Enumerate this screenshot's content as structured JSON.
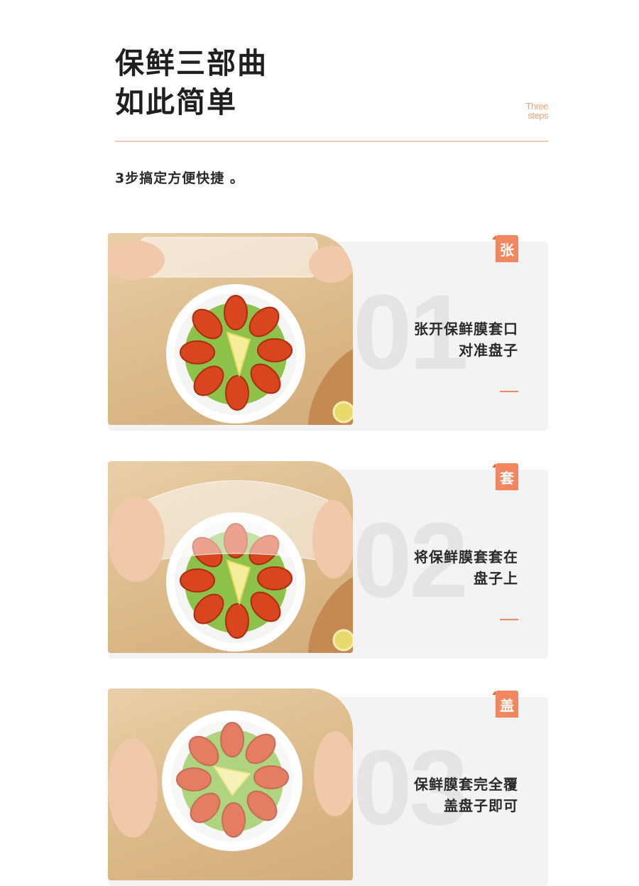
{
  "header": {
    "title_line1": "保鲜三部曲",
    "title_line2": "如此简单",
    "english_line1": "Three",
    "english_line2": "steps"
  },
  "subtitle": "3步搞定方便快捷 。",
  "colors": {
    "accent": "#f2875f",
    "divider": "#f7c9b4",
    "card_bg": "#f3f3f3"
  },
  "steps": [
    {
      "number": "01",
      "badge": "张",
      "line1": "张开保鲜膜套口",
      "line2": "对准盘子"
    },
    {
      "number": "02",
      "badge": "套",
      "line1": "将保鲜膜套套在",
      "line2": "盘子上"
    },
    {
      "number": "03",
      "badge": "盖",
      "line1": "保鲜膜套完全覆",
      "line2": "盖盘子即可"
    }
  ]
}
